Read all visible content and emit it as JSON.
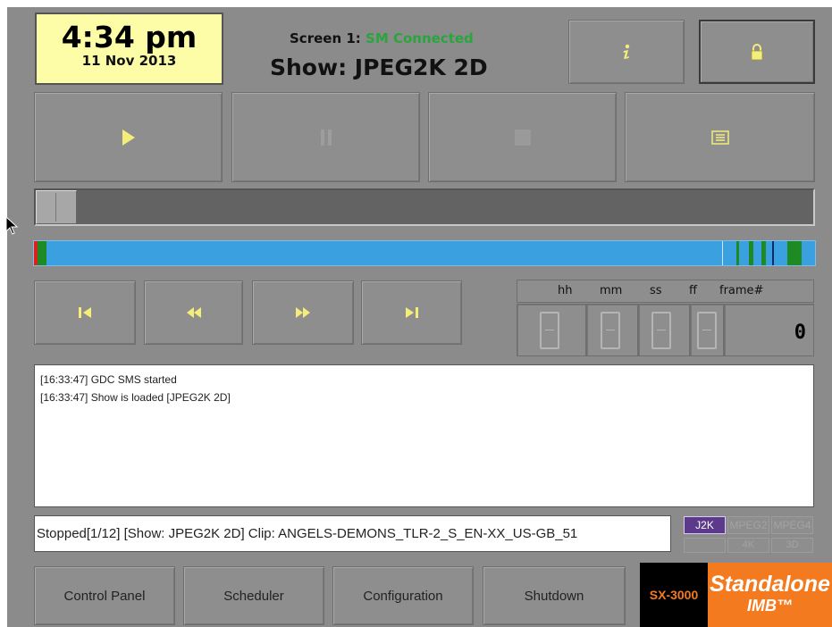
{
  "clock": {
    "time": "4:34 pm",
    "date": "11 Nov 2013"
  },
  "screen": {
    "label": "Screen 1:",
    "status": "SM Connected",
    "status_color": "#2aa53e"
  },
  "show": {
    "title": "Show: JPEG2K 2D"
  },
  "top_buttons": {
    "info_icon": "info-icon",
    "lock_icon": "lock-icon"
  },
  "transport": {
    "play_icon": "play-icon",
    "pause_icon": "pause-icon",
    "stop_icon": "stop-icon",
    "playlist_icon": "playlist-icon"
  },
  "progress": {
    "position": 0.0
  },
  "navigation": {
    "skip_start_icon": "skip-to-start-icon",
    "rewind_icon": "rewind-icon",
    "fast_forward_icon": "fast-forward-icon",
    "skip_end_icon": "skip-to-end-icon"
  },
  "timecode": {
    "headers": [
      "hh",
      "mm",
      "ss",
      "ff",
      "frame#"
    ],
    "frame_value": "0"
  },
  "log": {
    "lines": [
      "[16:33:47] GDC SMS started",
      "[16:33:47] Show is loaded [JPEG2K 2D]"
    ]
  },
  "status_bar": {
    "text": "Stopped[1/12] [Show: JPEG2K 2D] Clip: ANGELS-DEMONS_TLR-2_S_EN-XX_US-GB_51"
  },
  "codecs": {
    "j2k": "J2K",
    "mpeg2": "MPEG2",
    "mpeg4": "MPEG4",
    "row2_mid": "4K",
    "row2_right": "3D"
  },
  "bottom_nav": {
    "control_panel": "Control Panel",
    "scheduler": "Scheduler",
    "configuration": "Configuration",
    "shutdown": "Shutdown"
  },
  "logo": {
    "model": "SX-3000",
    "line1": "Standalone",
    "line2": "IMB™"
  },
  "colors": {
    "accent_timeline": "#3aa0e0",
    "clock_bg": "#fdfda8",
    "logo_orange": "#f47a20",
    "j2k_badge": "#5b3a8c"
  }
}
